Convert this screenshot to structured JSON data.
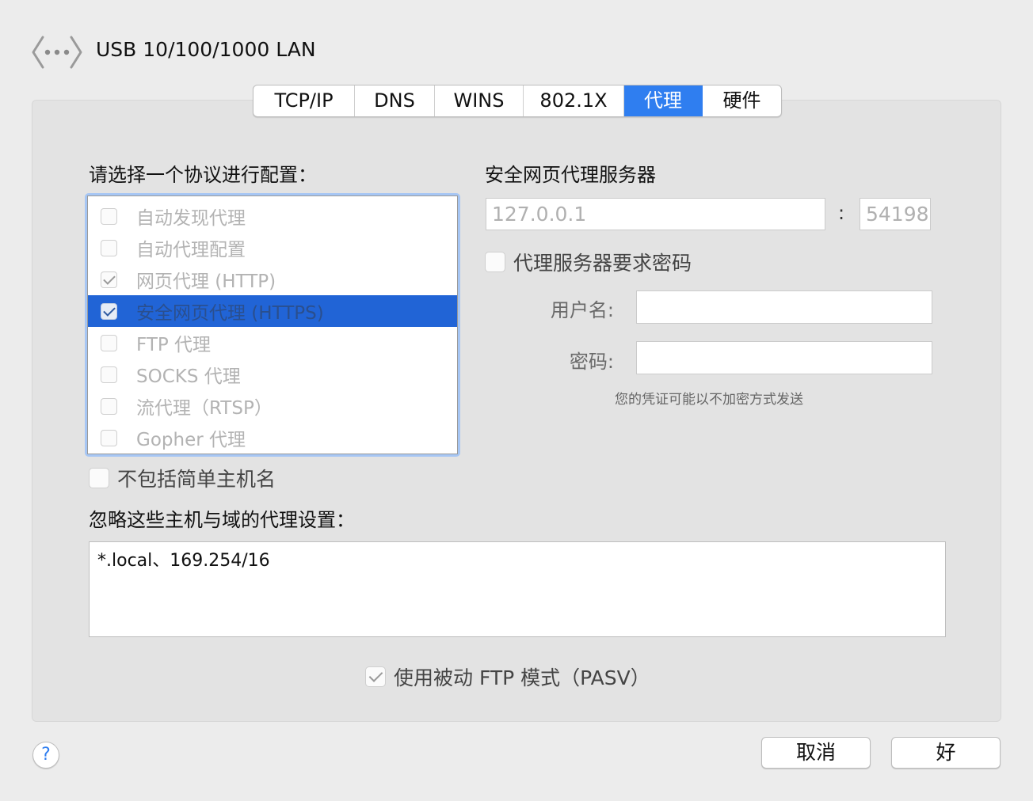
{
  "window": {
    "interface_title": "USB 10/100/1000 LAN",
    "interface_icon": "network-arrows-icon"
  },
  "tabs": [
    {
      "label": "TCP/IP",
      "active": false
    },
    {
      "label": "DNS",
      "active": false
    },
    {
      "label": "WINS",
      "active": false
    },
    {
      "label": "802.1X",
      "active": false
    },
    {
      "label": "代理",
      "active": true
    },
    {
      "label": "硬件",
      "active": false
    }
  ],
  "protocols": {
    "heading": "请选择一个协议进行配置：",
    "items": [
      {
        "label": "自动发现代理",
        "checked": false,
        "selected": false
      },
      {
        "label": "自动代理配置",
        "checked": false,
        "selected": false
      },
      {
        "label": "网页代理 (HTTP)",
        "checked": true,
        "selected": false
      },
      {
        "label": "安全网页代理 (HTTPS)",
        "checked": true,
        "selected": true
      },
      {
        "label": "FTP 代理",
        "checked": false,
        "selected": false
      },
      {
        "label": "SOCKS 代理",
        "checked": false,
        "selected": false
      },
      {
        "label": "流代理（RTSP）",
        "checked": false,
        "selected": false
      },
      {
        "label": "Gopher 代理",
        "checked": false,
        "selected": false
      }
    ]
  },
  "server": {
    "heading": "安全网页代理服务器",
    "host_value": "127.0.0.1",
    "separator": ":",
    "port_value": "54198",
    "require_password_label": "代理服务器要求密码",
    "require_password_checked": false,
    "username_label": "用户名:",
    "username_value": "",
    "password_label": "密码:",
    "password_value": "",
    "credential_note": "您的凭证可能以不加密方式发送"
  },
  "exclude_simple_hostnames": {
    "label": "不包括简单主机名",
    "checked": false
  },
  "bypass": {
    "heading": "忽略这些主机与域的代理设置：",
    "value": "*.local、169.254/16"
  },
  "passive_ftp": {
    "label": "使用被动 FTP 模式（PASV）",
    "checked": true
  },
  "buttons": {
    "help": "?",
    "cancel": "取消",
    "ok": "好"
  },
  "colors": {
    "accent": "#2f7ef0",
    "selection": "#2164d6",
    "background": "#ececec",
    "panel": "#e3e3e3"
  }
}
